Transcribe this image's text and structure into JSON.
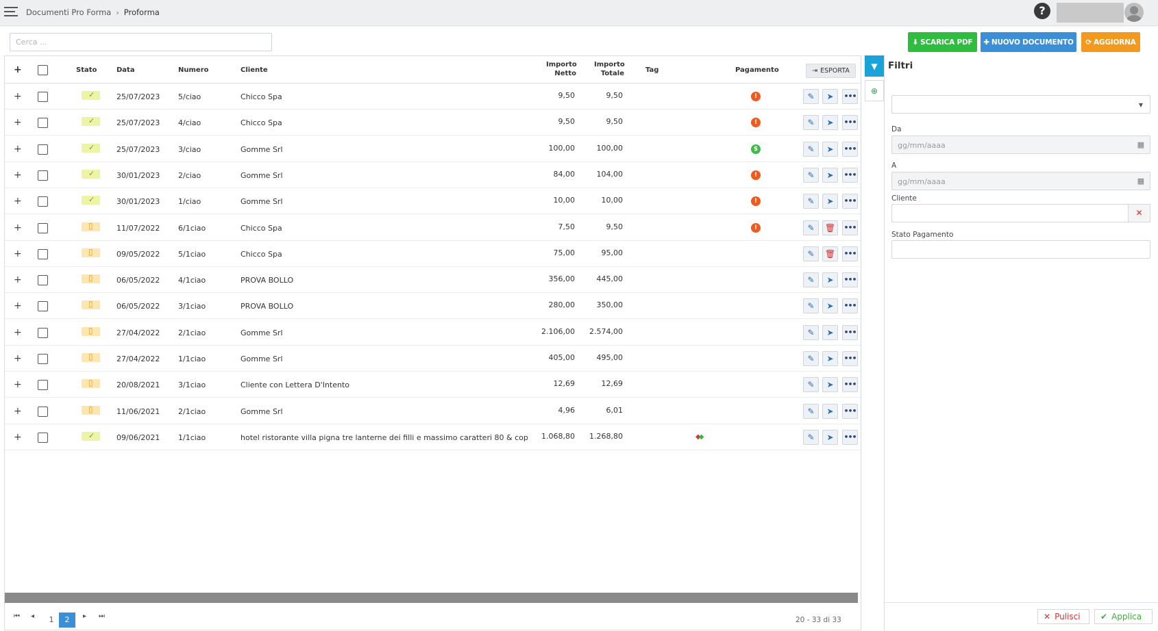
{
  "header": {
    "breadcrumb": [
      "Documenti Pro Forma",
      "Proforma"
    ]
  },
  "toolbar": {
    "search_placeholder": "Cerca ...",
    "pdf_label": "SCARICA PDF",
    "new_label": "NUOVO DOCUMENTO",
    "update_label": "AGGIORNA"
  },
  "table": {
    "columns": {
      "stato": "Stato",
      "data": "Data",
      "numero": "Numero",
      "cliente": "Cliente",
      "netto_1": "Importo",
      "netto_2": "Netto",
      "totale_1": "Importo",
      "totale_2": "Totale",
      "tag": "Tag",
      "pagamento": "Pagamento",
      "esporta": "ESPORTA"
    },
    "rows": [
      {
        "status": "ok",
        "data": "25/07/2023",
        "numero": "5/ciao",
        "cliente": "Chicco Spa",
        "netto": "9,50",
        "totale": "9,50",
        "pay": "warn",
        "action": "send",
        "tag": false
      },
      {
        "status": "ok",
        "data": "25/07/2023",
        "numero": "4/ciao",
        "cliente": "Chicco Spa",
        "netto": "9,50",
        "totale": "9,50",
        "pay": "warn",
        "action": "send",
        "tag": false
      },
      {
        "status": "ok",
        "data": "25/07/2023",
        "numero": "3/ciao",
        "cliente": "Gomme Srl",
        "netto": "100,00",
        "totale": "100,00",
        "pay": "good",
        "action": "send",
        "tag": false
      },
      {
        "status": "ok",
        "data": "30/01/2023",
        "numero": "2/ciao",
        "cliente": "Gomme Srl",
        "netto": "84,00",
        "totale": "104,00",
        "pay": "warn",
        "action": "send",
        "tag": false
      },
      {
        "status": "ok",
        "data": "30/01/2023",
        "numero": "1/ciao",
        "cliente": "Gomme Srl",
        "netto": "10,00",
        "totale": "10,00",
        "pay": "warn",
        "action": "send",
        "tag": false
      },
      {
        "status": "draft",
        "data": "11/07/2022",
        "numero": "6/1ciao",
        "cliente": "Chicco Spa",
        "netto": "7,50",
        "totale": "9,50",
        "pay": "warn",
        "action": "delete",
        "tag": false
      },
      {
        "status": "draft",
        "data": "09/05/2022",
        "numero": "5/1ciao",
        "cliente": "Chicco Spa",
        "netto": "75,00",
        "totale": "95,00",
        "pay": "",
        "action": "delete",
        "tag": false
      },
      {
        "status": "draft",
        "data": "06/05/2022",
        "numero": "4/1ciao",
        "cliente": "PROVA BOLLO",
        "netto": "356,00",
        "totale": "445,00",
        "pay": "",
        "action": "send",
        "tag": false
      },
      {
        "status": "draft",
        "data": "06/05/2022",
        "numero": "3/1ciao",
        "cliente": "PROVA BOLLO",
        "netto": "280,00",
        "totale": "350,00",
        "pay": "",
        "action": "send",
        "tag": false
      },
      {
        "status": "draft",
        "data": "27/04/2022",
        "numero": "2/1ciao",
        "cliente": "Gomme Srl",
        "netto": "2.106,00",
        "totale": "2.574,00",
        "pay": "",
        "action": "send",
        "tag": false
      },
      {
        "status": "draft",
        "data": "27/04/2022",
        "numero": "1/1ciao",
        "cliente": "Gomme Srl",
        "netto": "405,00",
        "totale": "495,00",
        "pay": "",
        "action": "send",
        "tag": false
      },
      {
        "status": "draft",
        "data": "20/08/2021",
        "numero": "3/1ciao",
        "cliente": "Cliente con Lettera D'Intento",
        "netto": "12,69",
        "totale": "12,69",
        "pay": "",
        "action": "send",
        "tag": false
      },
      {
        "status": "draft",
        "data": "11/06/2021",
        "numero": "2/1ciao",
        "cliente": "Gomme Srl",
        "netto": "4,96",
        "totale": "6,01",
        "pay": "",
        "action": "send",
        "tag": false
      },
      {
        "status": "ok",
        "data": "09/06/2021",
        "numero": "1/1ciao",
        "cliente": "hotel ristorante villa pigna tre lanterne dei filli e massimo caratteri 80 & cop",
        "netto": "1.068,80",
        "totale": "1.268,80",
        "pay": "",
        "action": "send",
        "tag": true
      }
    ]
  },
  "pager": {
    "pages": [
      "1",
      "2"
    ],
    "active": "2",
    "info": "20 - 33 di 33"
  },
  "filters": {
    "title": "Filtri",
    "da_label": "Da",
    "a_label": "A",
    "date_placeholder": "gg/mm/aaaa",
    "cliente_label": "Cliente",
    "stato_label": "Stato Pagamento",
    "clear_label": "Pulisci",
    "apply_label": "Applica"
  },
  "colors": {
    "pdf": "#2ebd3f",
    "new": "#3b8fd6",
    "update": "#f39a1e",
    "filter_tab": "#1aa3d9",
    "pay_warn": "#f05a1e",
    "pay_good": "#3fb94a"
  }
}
